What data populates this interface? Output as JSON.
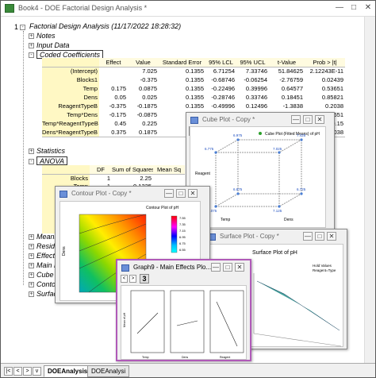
{
  "window": {
    "title": "Book4 - DOE Factorial Design Analysis *"
  },
  "report": {
    "root_title": "Factorial Design Analysis (11/17/2022 18:28:32)",
    "node_notes": "Notes",
    "node_input": "Input Data",
    "node_coded": "Coded Coefficients",
    "node_stats": "Statistics",
    "node_anova": "ANOVA",
    "node_means": "Means",
    "node_resid": "Resid",
    "node_effects": "Effects",
    "node_maineff": "Main E",
    "node_cube": "Cube P",
    "node_contour": "Contou",
    "node_surface": "Surface",
    "tree_one": "1",
    "coef_headers": [
      "Effect",
      "Value",
      "Standard Error",
      "95% LCL",
      "95% UCL",
      "t-Value",
      "Prob > |t|"
    ],
    "coef_rows": [
      {
        "label": "(Intercept)",
        "cells": [
          "",
          "7.025",
          "0.1355",
          "6.71254",
          "7.33746",
          "51.84625",
          "2.12243E-11"
        ]
      },
      {
        "label": "Blocks1",
        "cells": [
          "",
          "-0.375",
          "0.1355",
          "-0.68746",
          "-0.06254",
          "-2.76759",
          "0.02439"
        ]
      },
      {
        "label": "Temp",
        "cells": [
          "0.175",
          "0.0875",
          "0.1355",
          "-0.22496",
          "0.39996",
          "0.64577",
          "0.53651"
        ]
      },
      {
        "label": "Dens",
        "cells": [
          "0.05",
          "0.025",
          "0.1355",
          "-0.28746",
          "0.33746",
          "0.18451",
          "0.85821"
        ]
      },
      {
        "label": "ReagentTypeB",
        "cells": [
          "-0.375",
          "-0.1875",
          "0.1355",
          "-0.49996",
          "0.12496",
          "-1.3838",
          "0.2038"
        ]
      },
      {
        "label": "Temp*Dens",
        "cells": [
          "-0.175",
          "-0.0875",
          "0.1355",
          "-0.39996",
          "0.22496",
          "-0.64577",
          "0.53651"
        ]
      },
      {
        "label": "Temp*ReagentTypeB",
        "cells": [
          "0.45",
          "0.225",
          "",
          "",
          "",
          "",
          "0.15"
        ]
      },
      {
        "label": "Dens*ReagentTypeB",
        "cells": [
          "0.375",
          "0.1875",
          "",
          "",
          "",
          "",
          "0.2038"
        ]
      }
    ],
    "anova_headers": [
      "DF",
      "Sum of Squares",
      "Mean Sq"
    ],
    "anova_rows": [
      {
        "label": "Blocks",
        "cells": [
          "1",
          "2.25",
          ""
        ]
      },
      {
        "label": "Temp",
        "cells": [
          "1",
          "0.1225",
          ""
        ]
      },
      {
        "label": "Dens",
        "cells": [
          "1",
          "0.01",
          ""
        ]
      },
      {
        "label": "",
        "cells": [
          "",
          "",
          ""
        ]
      },
      {
        "label": "",
        "cells": [
          "",
          "",
          ""
        ]
      },
      {
        "label": "",
        "cells": [
          "",
          "",
          ""
        ]
      },
      {
        "label": "",
        "cells": [
          "",
          "",
          ""
        ]
      },
      {
        "label": "",
        "cells": [
          "",
          "",
          ""
        ]
      }
    ]
  },
  "cube_window": {
    "title": "Cube Plot - Copy *",
    "page": "1",
    "legend": "Cube Plot (Fitted Means) of pH",
    "axis_temp": "Temp",
    "axis_dens": "Dens",
    "axis_reagent": "Reagent",
    "corner_values": [
      "6.975",
      "7.425",
      "6.775",
      "7.025",
      "6.875",
      "6.725",
      "7.075",
      "7.125"
    ]
  },
  "contour_window": {
    "title": "Contour Plot - Copy *",
    "page": "1",
    "chart_title": "Contour Plot of pH",
    "ylabel": "Dens",
    "colorbar_ticks": [
      "7.55",
      "7.35",
      "7.15",
      "6.95",
      "6.75",
      "6.55"
    ]
  },
  "surface_window": {
    "title": "Surface Plot - Copy *",
    "page": "1",
    "chart_title": "Surface Plot of pH",
    "note_line1": "Hold Values",
    "note_line2": "Reagent=Type"
  },
  "graph9_window": {
    "title": "Graph9 - Main Effects Plo...",
    "page": "3",
    "ylabel": "Mean of pH",
    "xlabels": [
      "Temp",
      "Dens",
      "Reagent"
    ]
  },
  "tabs": {
    "nav_first": "|<",
    "nav_prev": "<",
    "nav_next": ">",
    "nav_menu": "v",
    "items": [
      "DOEAnalysis",
      "DOEAnalysi"
    ]
  }
}
